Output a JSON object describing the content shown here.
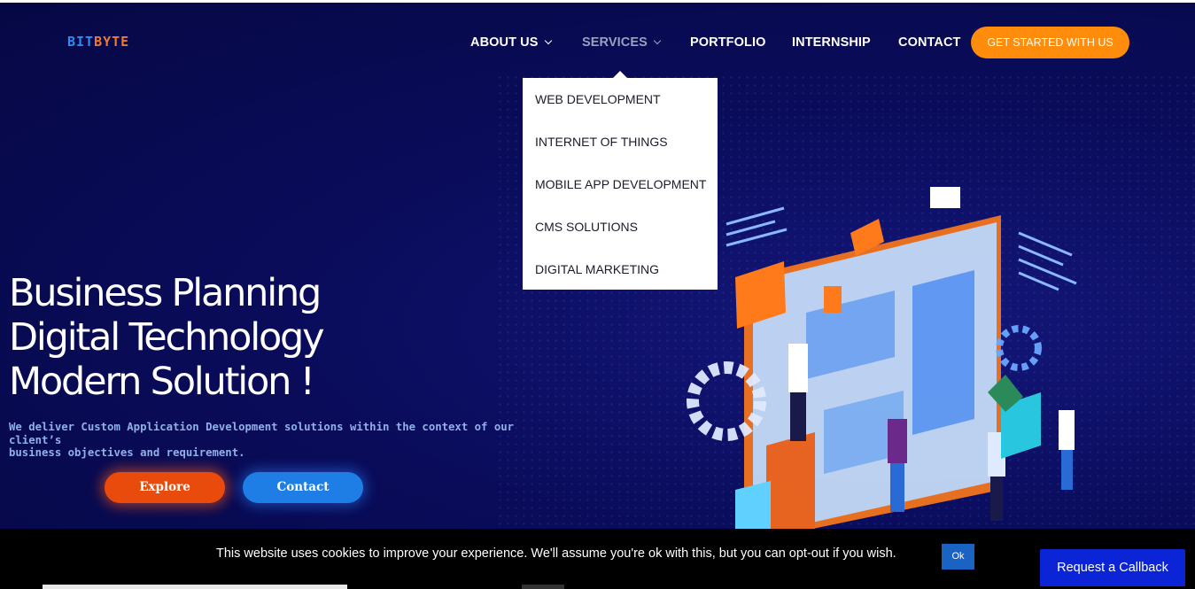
{
  "header": {
    "logo_part1": "BIT",
    "logo_part2": "BYTE",
    "nav": [
      {
        "label": "ABOUT US",
        "has_dropdown": true
      },
      {
        "label": "SERVICES",
        "has_dropdown": true,
        "active": true
      },
      {
        "label": "PORTFOLIO"
      },
      {
        "label": "INTERNSHIP"
      },
      {
        "label": "CONTACT"
      }
    ],
    "cta_label": "GET STARTED WITH US"
  },
  "services_menu": [
    "WEB DEVELOPMENT",
    "INTERNET OF THINGS",
    "MOBILE APP DEVELOPMENT",
    "CMS SOLUTIONS",
    "DIGITAL MARKETING"
  ],
  "hero": {
    "headline": [
      "Business Planning",
      "Digital Technology",
      "Modern Solution !"
    ],
    "subtext_line1": "We deliver Custom Application Development solutions within the context of our client’s",
    "subtext_line2": "business objectives and requirement.",
    "explore_label": "Explore",
    "contact_label": "Contact",
    "illustration_icon": "isometric-web-team-illustration"
  },
  "cookie_bar": {
    "text": "This website uses cookies to improve your experience. We'll assume you're ok with this, but you can opt-out if you wish.",
    "ok_label": "Ok"
  },
  "callback_label": "Request a Callback",
  "colors": {
    "background": "#0a0c5c",
    "accent_orange": "#ff8c0a",
    "explore": "#e84b0c",
    "contact": "#1f7ee6",
    "callback": "#0a24d6"
  }
}
